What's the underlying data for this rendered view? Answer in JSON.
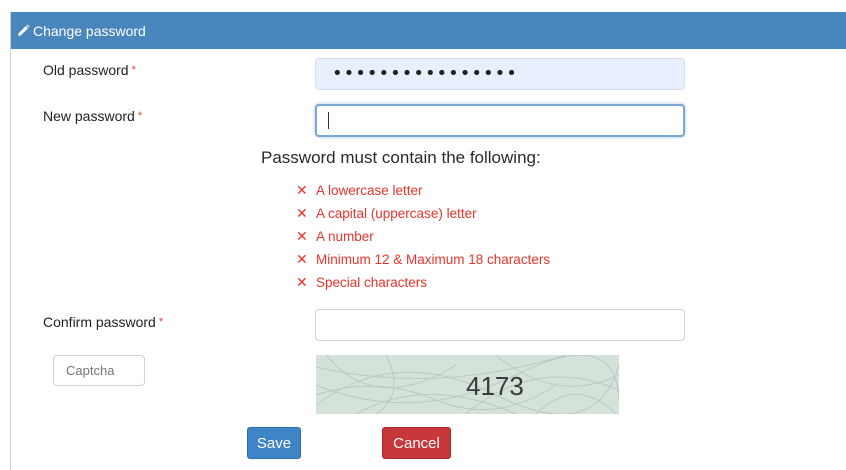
{
  "header": {
    "title": "Change password",
    "icon": "pencil-icon"
  },
  "form": {
    "old_password": {
      "label": "Old password",
      "required_mark": "*",
      "masked_value": "••••••••••••••••"
    },
    "new_password": {
      "label": "New password",
      "required_mark": "*",
      "value": ""
    },
    "requirements": {
      "title": "Password must contain the following:",
      "mark": "✕",
      "items": [
        "A lowercase letter",
        "A capital (uppercase) letter",
        "A number",
        "Minimum 12 & Maximum 18 characters",
        "Special characters"
      ]
    },
    "confirm_password": {
      "label": "Confirm password",
      "required_mark": "*",
      "value": ""
    },
    "captcha": {
      "placeholder": "Captcha",
      "challenge_text": "4173"
    }
  },
  "buttons": {
    "save": "Save",
    "cancel": "Cancel"
  },
  "colors": {
    "header": "#4a86be",
    "error": "#e8342c",
    "save": "#3f84c6",
    "cancel": "#c8383a",
    "autofill": "#e8f0fe"
  }
}
